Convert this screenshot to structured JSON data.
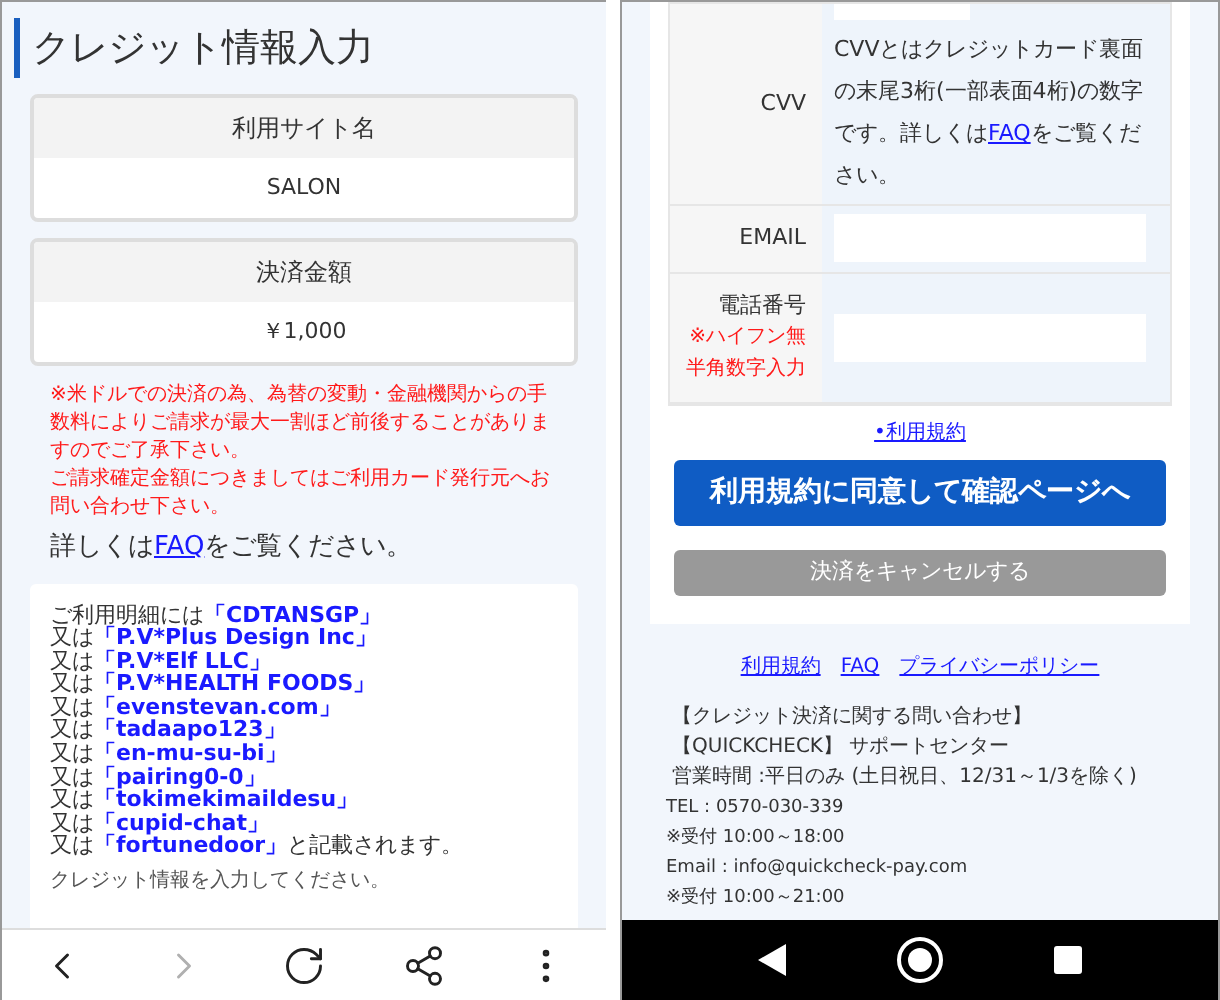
{
  "left_screen": {
    "title": "クレジット情報入力",
    "info_cards": [
      {
        "label": "利用サイト名",
        "value": "SALON"
      },
      {
        "label": "決済金額",
        "value": "￥1,000"
      }
    ],
    "notices": [
      "※米ドルでの決済の為、為替の変動・金融機関からの手数料によりご請求が最大一割ほど前後することがありますのでご了承下さい。",
      "ご請求確定金額につきましてはご利用カード発行元へお問い合わせ下さい。"
    ],
    "faq_sentence": {
      "before": "詳しくは",
      "link": "FAQ",
      "after": "をご覧ください。"
    },
    "statement_lines": [
      {
        "prefix": "ご利用明細には",
        "name": "「CDTANSGP」"
      },
      {
        "prefix": "又は",
        "name": "「P.V*Plus Design Inc」"
      },
      {
        "prefix": "又は",
        "name": "「P.V*Elf LLC」"
      },
      {
        "prefix": "又は",
        "name": "「P.V*HEALTH FOODS」"
      },
      {
        "prefix": "又は",
        "name": "「evenstevan.com」"
      },
      {
        "prefix": "又は",
        "name": "「tadaapo123」"
      },
      {
        "prefix": "又は",
        "name": "「en-mu-su-bi」"
      },
      {
        "prefix": "又は",
        "name": "「pairing0-0」"
      },
      {
        "prefix": "又は",
        "name": "「tokimekimaildesu」"
      },
      {
        "prefix": "又は",
        "name": "「cupid-chat」"
      },
      {
        "prefix": "又は",
        "name": "「fortunedoor」",
        "suffix": "と記載されます。"
      }
    ],
    "instruction": "クレジット情報を入力してください。",
    "toolbar": [
      {
        "kind": "back",
        "disabled": false
      },
      {
        "kind": "forward",
        "disabled": true
      },
      {
        "kind": "reload",
        "disabled": false
      },
      {
        "kind": "share",
        "disabled": false
      },
      {
        "kind": "more",
        "disabled": false
      }
    ]
  },
  "right_screen": {
    "form_rows": [
      {
        "kind": "help",
        "label": "CVV",
        "help": {
          "before": "CVVとはクレジットカード裏面の末尾3桁(一部表面4桁)の数字です。詳しくは",
          "link": "FAQ",
          "after": "をご覧ください。"
        }
      },
      {
        "kind": "input",
        "label": "EMAIL"
      },
      {
        "kind": "input",
        "label": "電話番号",
        "note_lines": [
          "※ハイフン無",
          "半角数字入力"
        ]
      }
    ],
    "terms_link": "•利用規約",
    "agree_button": "利用規約に同意して確認ページへ",
    "cancel_button": "決済をキャンセルする",
    "footer_links": [
      "利用規約",
      "FAQ",
      "プライバシーポリシー"
    ],
    "contact_lines": [
      {
        "text": "【クレジット決済に関する問い合わせ】",
        "kind": "heading"
      },
      {
        "text": "【QUICKCHECK】 サポートセンター",
        "kind": "heading"
      },
      {
        "text": "営業時間 :平日のみ (土日祝日、12/31～1/3を除く)",
        "kind": "heading"
      },
      {
        "text": "TEL : 0570-030-339",
        "kind": "small"
      },
      {
        "text": "※受付 10:00～18:00",
        "kind": "small"
      },
      {
        "text": "Email : info@quickcheck-pay.com",
        "kind": "small"
      },
      {
        "text": "※受付 10:00～21:00",
        "kind": "small"
      }
    ]
  }
}
